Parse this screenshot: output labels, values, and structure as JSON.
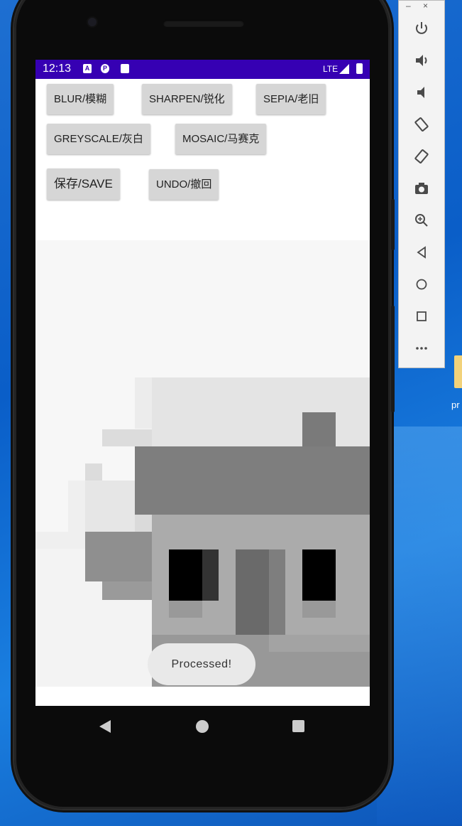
{
  "status_bar": {
    "time": "12:13",
    "network": "LTE"
  },
  "buttons": {
    "blur": "BLUR/模糊",
    "sharpen": "SHARPEN/锐化",
    "sepia": "SEPIA/老旧",
    "greyscale": "GREYSCALE/灰白",
    "mosaic": "MOSAIC/马赛克",
    "save": "保存/SAVE",
    "undo": "UNDO/撤回"
  },
  "toast": {
    "message": "Processed!"
  },
  "desktop": {
    "icon_label": "pr"
  },
  "emulator_toolbar": {
    "minimize": "–",
    "close": "×",
    "icons": [
      "power-icon",
      "volume-up-icon",
      "volume-down-icon",
      "rotate-left-icon",
      "rotate-right-icon",
      "camera-icon",
      "zoom-icon",
      "back-icon",
      "home-icon",
      "overview-icon",
      "more-icon"
    ]
  },
  "colors": {
    "status_bar": "#3600b3",
    "button_bg": "#d6d6d6",
    "toast_bg": "#e9e9e9"
  }
}
